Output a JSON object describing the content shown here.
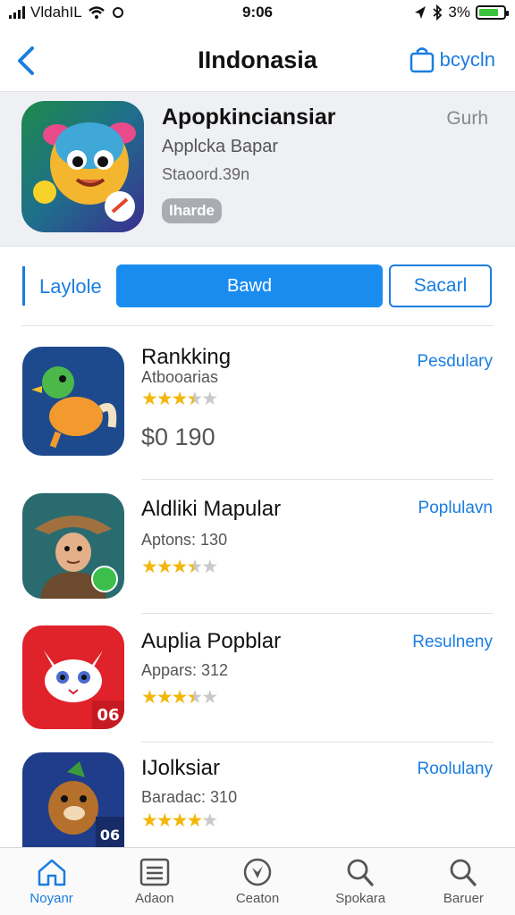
{
  "status_bar": {
    "carrier": "VldahIL",
    "time": "9:06",
    "battery": "3%"
  },
  "nav": {
    "title": "IIndonasia",
    "action_label": "bcycln"
  },
  "featured": {
    "name": "Apopkinciansiar",
    "subtitle": "Applcka Bapar",
    "meta": "Staoord.39n",
    "badge": "Iharde",
    "side_label": "Gurh"
  },
  "segments": {
    "left": "Laylole",
    "middle": "Bawd",
    "right": "Sacarl"
  },
  "apps": [
    {
      "title": "Rankking",
      "subtitle": "Atbooarias",
      "stars_on": 3.5,
      "stars_total": 5,
      "price": "$0 190",
      "tag": "Pesdulary",
      "colors": [
        "#1d4a8c",
        "#f29a2e"
      ]
    },
    {
      "title": "Aldliki Mapular",
      "subtitle": "Aptons: 130",
      "stars_on": 3.5,
      "stars_total": 5,
      "tag": "Poplulavn",
      "colors": [
        "#2a6b70",
        "#8b5a35"
      ]
    },
    {
      "title": "Auplia Popblar",
      "subtitle": "Appars: 312",
      "stars_on": 3.5,
      "stars_total": 5,
      "tag": "Resulneny",
      "colors": [
        "#e0222b",
        "#ffffff"
      ],
      "icon_badge": "06"
    },
    {
      "title": "IJolksiar",
      "subtitle": "Baradac: 310",
      "stars_on": 4,
      "stars_total": 5,
      "tag": "Roolulany",
      "colors": [
        "#1f3d8a",
        "#b5702c"
      ],
      "icon_badge": "06"
    }
  ],
  "tabs": [
    {
      "label": "Noyanr",
      "icon": "home-icon",
      "active": true
    },
    {
      "label": "Adaon",
      "icon": "list-icon",
      "active": false
    },
    {
      "label": "Ceaton",
      "icon": "compass-icon",
      "active": false
    },
    {
      "label": "Spokara",
      "icon": "search-icon",
      "active": false
    },
    {
      "label": "Baruer",
      "icon": "search-icon",
      "active": false
    }
  ],
  "accent_color": "#1a7de0"
}
